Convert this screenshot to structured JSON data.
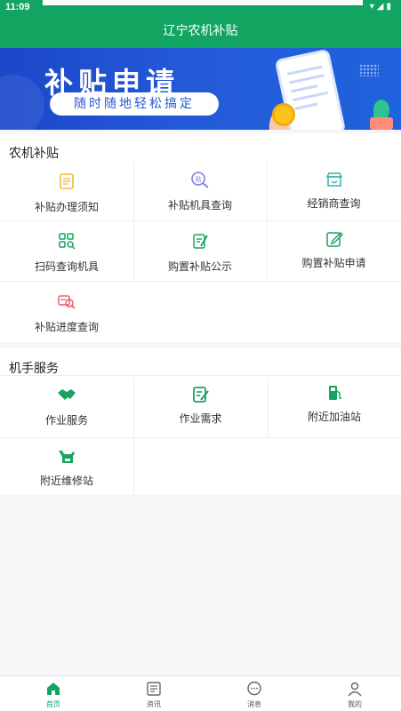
{
  "status_bar": {
    "time": "11:09",
    "icons": "▾◢▮"
  },
  "header": {
    "title": "辽宁农机补贴"
  },
  "banner": {
    "headline": "补贴申请",
    "subtitle": "随时随地轻松搞定"
  },
  "subsidy_section": {
    "title": "农机补贴",
    "items": [
      {
        "label": "补贴办理须知"
      },
      {
        "label": "补贴机具查询"
      },
      {
        "label": "经销商查询"
      },
      {
        "label": "扫码查询机具"
      },
      {
        "label": "购置补贴公示"
      },
      {
        "label": "购置补贴申请"
      },
      {
        "label": "补贴进度查询"
      }
    ]
  },
  "operator_section": {
    "title": "机手服务",
    "items": [
      {
        "label": "作业服务"
      },
      {
        "label": "作业需求"
      },
      {
        "label": "附近加油站"
      },
      {
        "label": "附近维修站"
      }
    ]
  },
  "tabs": [
    {
      "label": "首页",
      "active": true
    },
    {
      "label": "资讯",
      "active": false
    },
    {
      "label": "消息",
      "active": false
    },
    {
      "label": "我的",
      "active": false
    }
  ],
  "colors": {
    "brand": "#12a561",
    "icon_orange": "#f3b93c",
    "icon_purple": "#7c7fe6",
    "icon_teal": "#3bb1a6",
    "icon_green": "#18a35e",
    "icon_red": "#ea5a6a"
  }
}
